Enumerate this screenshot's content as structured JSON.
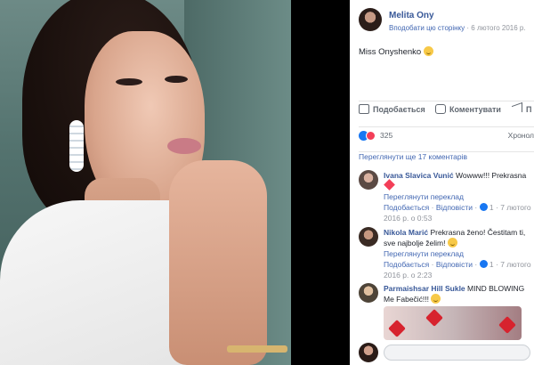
{
  "post": {
    "author": "Melita Ony",
    "follow": "Вподобати цю сторінку",
    "date": "6 лютого 2016 р.",
    "text": "Miss Onyshenko"
  },
  "actions": {
    "like": "Подобається",
    "comment": "Коментувати",
    "share": "П"
  },
  "reactions": {
    "count": "325",
    "sort": "Хронол"
  },
  "more_comments": "Переглянути ще 17 коментарів",
  "comments": [
    {
      "name": "Ivana Slavica Vunić",
      "text": "Wowww!!! Prekrasna",
      "translate": "Переглянути переклад",
      "like": "Подобається",
      "reply": "Відповісти",
      "likes": "1",
      "time": "7 лютого 2016 р. о 0:53"
    },
    {
      "name": "Nikola Marić",
      "text": "Prekrasna ženo! Čestitam ti, sve najbolje želim!",
      "translate": "Переглянути переклад",
      "like": "Подобається",
      "reply": "Відповісти",
      "likes": "1",
      "time": "7 лютого 2016 р. о 2:23"
    },
    {
      "name": "Parmaishsar Hill Sukle",
      "text": "MIND BLOWING Me Fabečić!!!"
    }
  ],
  "colors": {
    "link": "#385898",
    "accent": "#4267b2",
    "muted": "#90949c",
    "love": "#f33e58",
    "like": "#1877f2"
  }
}
